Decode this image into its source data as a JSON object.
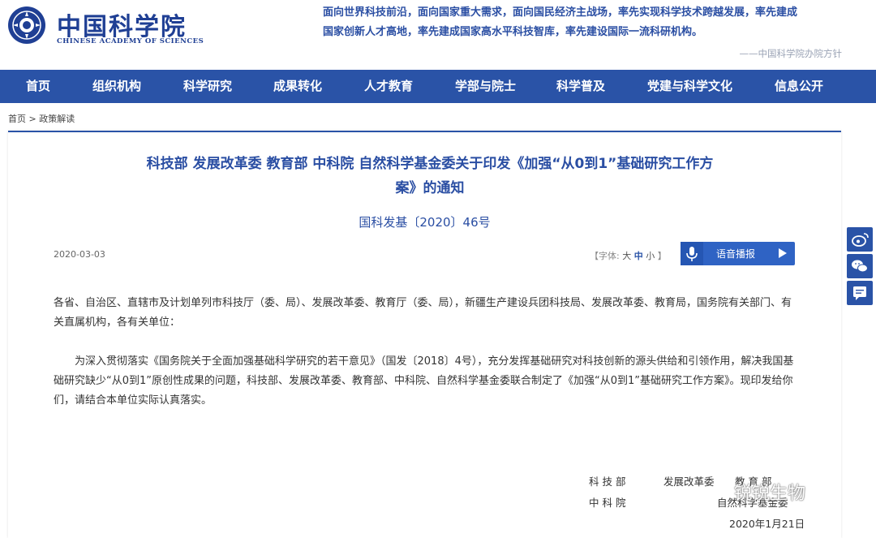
{
  "header": {
    "logo_cn": "中国科学院",
    "logo_en": "CHINESE ACADEMY OF SCIENCES",
    "motto_line1": "面向世界科技前沿，面向国家重大需求，面向国民经济主战场，率先实现科学技术跨越发展，率先建成",
    "motto_line2": "国家创新人才高地，率先建成国家高水平科技智库，率先建设国际一流科研机构。",
    "motto_source": "——中国科学院办院方针"
  },
  "nav": {
    "items": [
      {
        "label": "首页"
      },
      {
        "label": "组织机构"
      },
      {
        "label": "科学研究"
      },
      {
        "label": "成果转化"
      },
      {
        "label": "人才教育"
      },
      {
        "label": "学部与院士"
      },
      {
        "label": "科学普及"
      },
      {
        "label": "党建与科学文化"
      },
      {
        "label": "信息公开"
      }
    ]
  },
  "breadcrumb": {
    "home": "首页",
    "sep": ">",
    "current": "政策解读"
  },
  "article": {
    "title_line1": "科技部 发展改革委 教育部 中科院 自然科学基金委关于印发《加强“从0到1”基础研究工作方",
    "title_line2": "案》的通知",
    "doc_number": "国科发基〔2020〕46号",
    "date": "2020-03-03",
    "fontsize": {
      "prefix": "【字体:",
      "large": "大",
      "medium": "中",
      "small": "小",
      "suffix": "】"
    },
    "audio_label": "语音播报",
    "paragraph1": "各省、自治区、直辖市及计划单列市科技厅（委、局）、发展改革委、教育厅（委、局），新疆生产建设兵团科技局、发展改革委、教育局，国务院有关部门、有关直属机构，各有关单位：",
    "paragraph2": "为深入贯彻落实《国务院关于全面加强基础科学研究的若干意见》（国发〔2018〕4号），充分发挥基础研究对科技创新的源头供给和引领作用，解决我国基础研究缺少“从0到1”原创性成果的问题，科技部、发展改革委、教育部、中科院、自然科学基金委联合制定了《加强“从0到1”基础研究工作方案》。现印发给你们，请结合本单位实际认真落实。",
    "signatures": {
      "row1_a": "科 技 部",
      "row1_b": "发展改革委",
      "row1_c": "教 育 部",
      "row2_a": "中 科 院",
      "row2_b": "自然科学基金委",
      "date": "2020年1月21日"
    }
  },
  "watermark": "锐锐生物",
  "icons": {
    "weibo": "weibo-icon",
    "wechat": "wechat-icon",
    "comment": "comment-icon",
    "mic": "microphone-icon",
    "play": "play-icon"
  },
  "colors": {
    "nav_bg": "#2a53a7",
    "title": "#2a4ea3",
    "audio_btn": "#2f63c4"
  }
}
